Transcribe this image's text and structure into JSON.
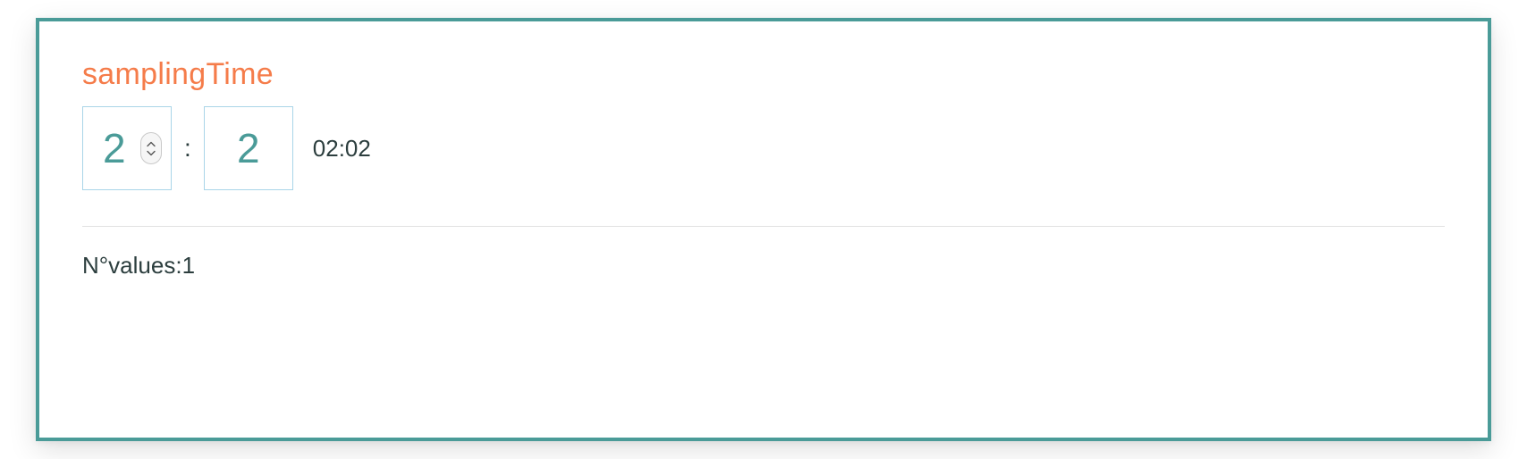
{
  "title": "samplingTime",
  "time": {
    "hours": "2",
    "minutes": "2",
    "separator": ":",
    "display": "02:02"
  },
  "footer": {
    "values_label": "N°values:",
    "values_count": "1"
  }
}
